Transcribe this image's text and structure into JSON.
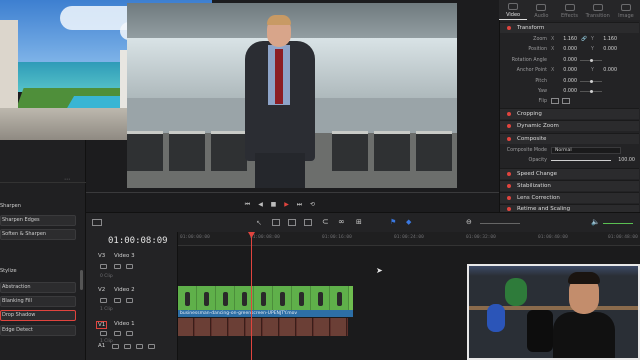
{
  "inspector": {
    "tabs": [
      "Video",
      "Audio",
      "Effects",
      "Transition",
      "Image"
    ],
    "active_tab": "Video",
    "sections": {
      "transform": "Transform",
      "cropping": "Cropping",
      "dynamic_zoom": "Dynamic Zoom",
      "composite": "Composite",
      "speed_change": "Speed Change",
      "stabilization": "Stabilization",
      "lens_correction": "Lens Correction",
      "retime_scaling": "Retime and Scaling"
    },
    "transform": {
      "zoom_label": "Zoom",
      "zoom_x": "1.160",
      "zoom_y": "1.160",
      "position_label": "Position",
      "position_x": "0.000",
      "position_y": "0.000",
      "rotation_label": "Rotation Angle",
      "rotation": "0.000",
      "anchor_label": "Anchor Point",
      "anchor_x": "0.000",
      "anchor_y": "0.000",
      "pitch_label": "Pitch",
      "pitch": "0.000",
      "yaw_label": "Yaw",
      "yaw": "0.000",
      "flip_label": "Flip",
      "x_axis": "X",
      "y_axis": "Y"
    },
    "composite": {
      "mode_label": "Composite Mode",
      "mode_value": "Normal",
      "opacity_label": "Opacity",
      "opacity_value": "100.00"
    }
  },
  "effects_panel": {
    "items": [
      "Sharpen",
      "Sharpen Edges",
      "Soften & Sharpen",
      "Stylize",
      "Abstraction",
      "Blanking Fill",
      "Drop Shadow",
      "Edge Detect"
    ],
    "selected": "Drop Shadow"
  },
  "timeline": {
    "timecode": "01:00:08:09",
    "ruler_ticks": [
      "01:00:00:00",
      "01:00:08:00",
      "01:00:16:00",
      "01:00:24:00",
      "01:00:32:00",
      "01:00:40:00",
      "01:00:48:00"
    ],
    "tracks": [
      {
        "id": "V3",
        "name": "Video 3",
        "clips": "0 Clip"
      },
      {
        "id": "V2",
        "name": "Video 2",
        "clips": "1 Clip"
      },
      {
        "id": "V1",
        "name": "Video 1",
        "clips": "1 Clip"
      },
      {
        "id": "A1",
        "name": "",
        "clips": ""
      }
    ],
    "clip_label": "businessman-dancing-on-greenscreen-UPENJTY.mov"
  },
  "transport": {
    "icons": [
      "skip-back-icon",
      "play-reverse-icon",
      "stop-icon",
      "play-icon",
      "skip-forward-icon",
      "loop-icon"
    ]
  },
  "colors": {
    "accent_red": "#e0443e",
    "clip_green": "#6ebd4f",
    "clip_label_blue": "#2d6fa6",
    "audio_clip": "#5c2f2a"
  }
}
